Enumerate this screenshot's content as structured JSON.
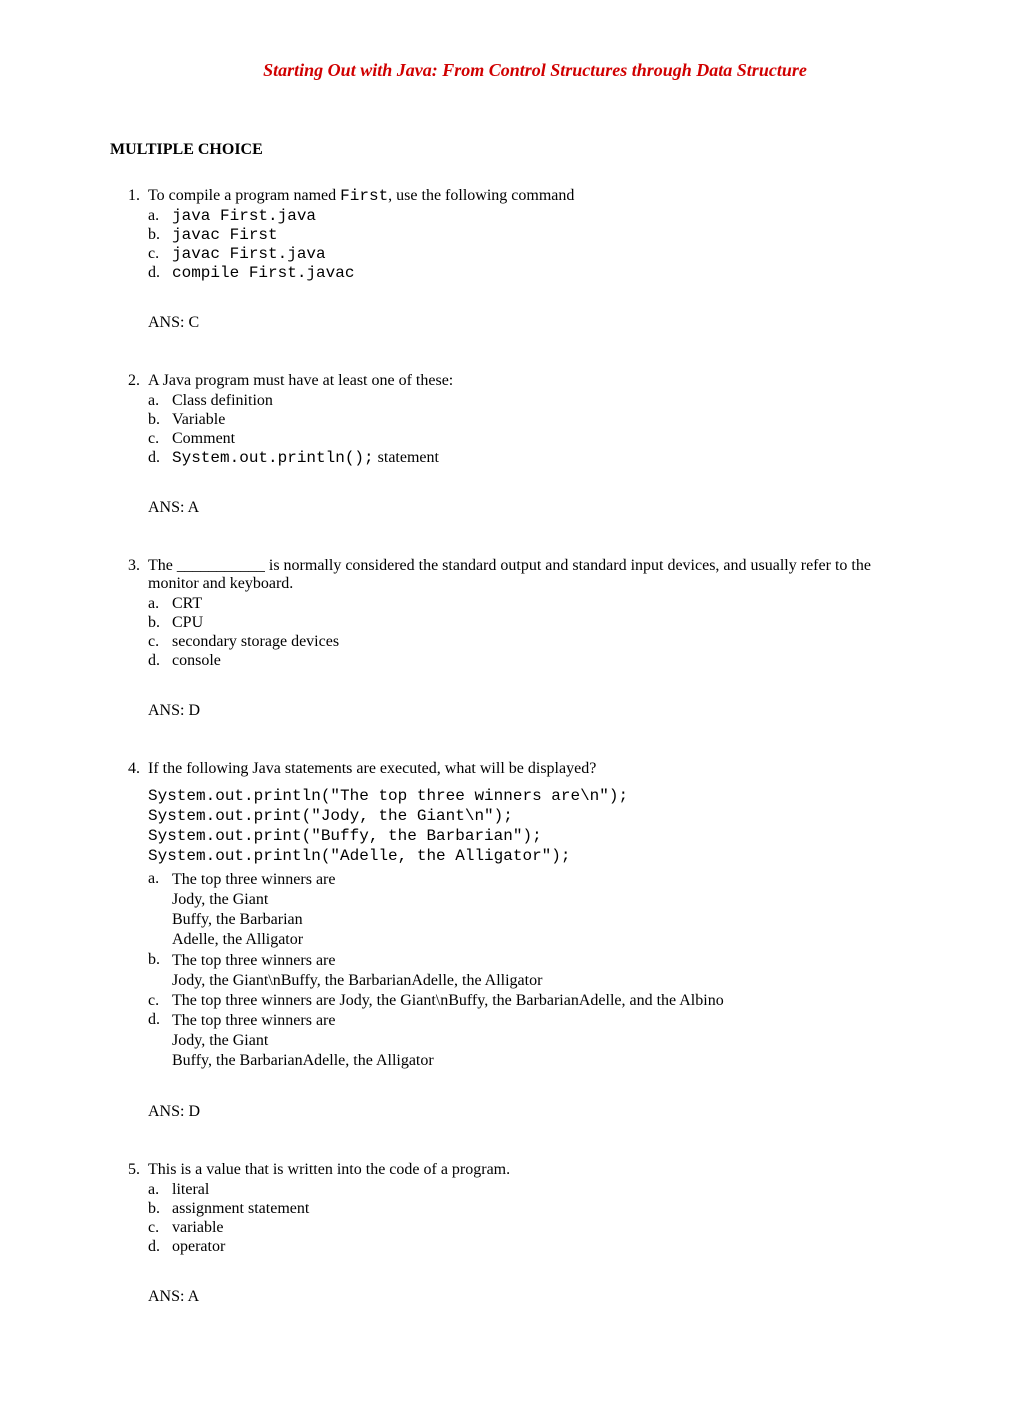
{
  "header": {
    "title": "Starting Out with Java: From Control Structures through Data Structure"
  },
  "section_heading": "MULTIPLE CHOICE",
  "q1": {
    "num": "1.",
    "stem_pre": "To compile a program named ",
    "stem_code": "First",
    "stem_post": ", use the following command",
    "a_label": "a.",
    "a_text": "java First.java",
    "b_label": "b.",
    "b_text": "javac First",
    "c_label": "c.",
    "c_text": "javac First.java",
    "d_label": "d.",
    "d_text": "compile First.javac",
    "ans": "ANS:   C"
  },
  "q2": {
    "num": "2.",
    "stem": "A Java program must have at least one of these:",
    "a_label": "a.",
    "a_text": "Class definition",
    "b_label": "b.",
    "b_text": "Variable",
    "c_label": "c.",
    "c_text": "Comment",
    "d_label": "d.",
    "d_code": "System.out.println();",
    "d_post": " statement",
    "ans": "ANS:   A"
  },
  "q3": {
    "num": "3.",
    "stem": "The ___________ is normally considered the standard output and standard input devices, and usually refer to the monitor and keyboard.",
    "a_label": "a.",
    "a_text": "CRT",
    "b_label": "b.",
    "b_text": "CPU",
    "c_label": "c.",
    "c_text": "secondary storage devices",
    "d_label": "d.",
    "d_text": "console",
    "ans": "ANS:   D"
  },
  "q4": {
    "num": "4.",
    "stem": "If the following Java statements are executed, what will be displayed?",
    "code": "System.out.println(\"The top three winners are\\n\");\nSystem.out.print(\"Jody, the Giant\\n\");\nSystem.out.print(\"Buffy, the Barbarian\");\nSystem.out.println(\"Adelle, the Alligator\");",
    "a_label": "a.",
    "a_l1": "The top three winners are",
    "a_l2": "Jody, the Giant",
    "a_l3": "Buffy, the Barbarian",
    "a_l4": "Adelle, the Alligator",
    "b_label": "b.",
    "b_l1": "The top three winners are",
    "b_l2": "Jody, the Giant\\nBuffy, the BarbarianAdelle, the Alligator",
    "c_label": "c.",
    "c_text": "The top three winners are Jody, the Giant\\nBuffy, the BarbarianAdelle, and the Albino",
    "d_label": "d.",
    "d_l1": "The top three winners are",
    "d_l2": "Jody, the Giant",
    "d_l3": "Buffy, the BarbarianAdelle, the Alligator",
    "ans": "ANS:   D"
  },
  "q5": {
    "num": "5.",
    "stem": "This is a value that is written into the code of a program.",
    "a_label": "a.",
    "a_text": "literal",
    "b_label": "b.",
    "b_text": "assignment statement",
    "c_label": "c.",
    "c_text": "variable",
    "d_label": "d.",
    "d_text": "operator",
    "ans": "ANS:   A"
  }
}
